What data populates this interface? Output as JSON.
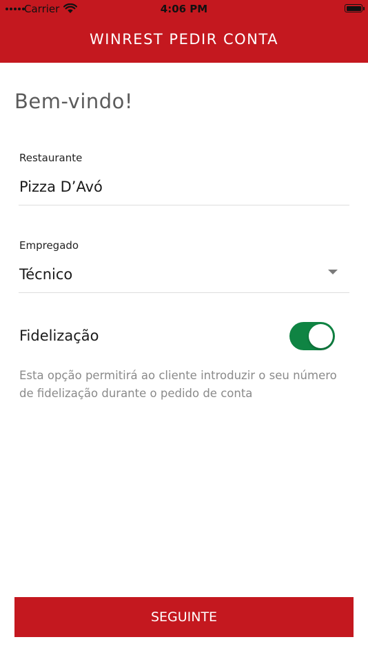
{
  "status_bar": {
    "carrier": "Carrier",
    "time": "4:06 PM"
  },
  "header": {
    "title": "WINREST PEDIR CONTA",
    "background_color": "#c4181f"
  },
  "main": {
    "welcome": "Bem-vindo!",
    "restaurant": {
      "label": "Restaurante",
      "value": "Pizza D’Avó"
    },
    "employee": {
      "label": "Empregado",
      "value": "Técnico",
      "icon": "dropdown-arrow-icon"
    },
    "loyalty": {
      "label": "Fidelização",
      "enabled": true,
      "toggle_color": "#0f8443",
      "description": "Esta opção permitirá ao cliente introduzir o seu número de fidelização durante o pedido de conta"
    }
  },
  "footer": {
    "next_label": "SEGUINTE"
  }
}
